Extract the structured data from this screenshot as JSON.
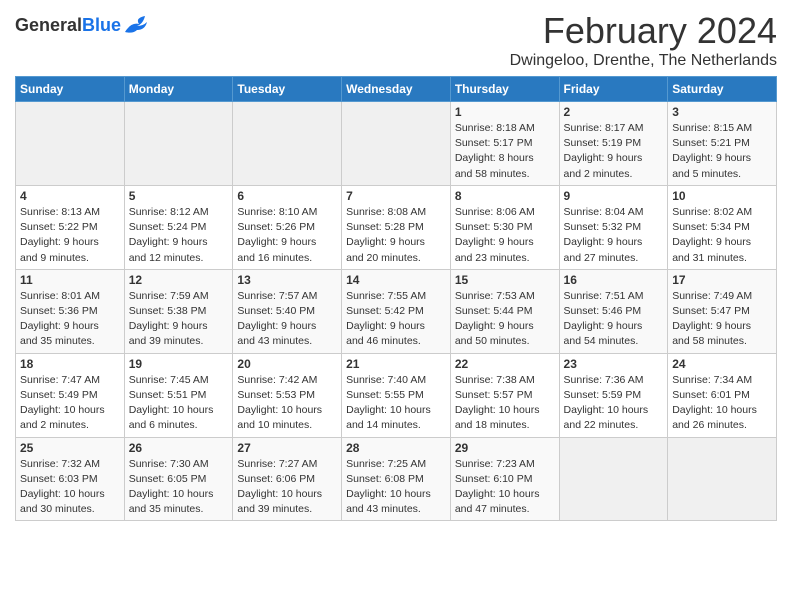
{
  "header": {
    "logo_general": "General",
    "logo_blue": "Blue",
    "month_title": "February 2024",
    "location": "Dwingeloo, Drenthe, The Netherlands"
  },
  "days_of_week": [
    "Sunday",
    "Monday",
    "Tuesday",
    "Wednesday",
    "Thursday",
    "Friday",
    "Saturday"
  ],
  "weeks": [
    [
      {
        "day": "",
        "info": ""
      },
      {
        "day": "",
        "info": ""
      },
      {
        "day": "",
        "info": ""
      },
      {
        "day": "",
        "info": ""
      },
      {
        "day": "1",
        "info": "Sunrise: 8:18 AM\nSunset: 5:17 PM\nDaylight: 8 hours\nand 58 minutes."
      },
      {
        "day": "2",
        "info": "Sunrise: 8:17 AM\nSunset: 5:19 PM\nDaylight: 9 hours\nand 2 minutes."
      },
      {
        "day": "3",
        "info": "Sunrise: 8:15 AM\nSunset: 5:21 PM\nDaylight: 9 hours\nand 5 minutes."
      }
    ],
    [
      {
        "day": "4",
        "info": "Sunrise: 8:13 AM\nSunset: 5:22 PM\nDaylight: 9 hours\nand 9 minutes."
      },
      {
        "day": "5",
        "info": "Sunrise: 8:12 AM\nSunset: 5:24 PM\nDaylight: 9 hours\nand 12 minutes."
      },
      {
        "day": "6",
        "info": "Sunrise: 8:10 AM\nSunset: 5:26 PM\nDaylight: 9 hours\nand 16 minutes."
      },
      {
        "day": "7",
        "info": "Sunrise: 8:08 AM\nSunset: 5:28 PM\nDaylight: 9 hours\nand 20 minutes."
      },
      {
        "day": "8",
        "info": "Sunrise: 8:06 AM\nSunset: 5:30 PM\nDaylight: 9 hours\nand 23 minutes."
      },
      {
        "day": "9",
        "info": "Sunrise: 8:04 AM\nSunset: 5:32 PM\nDaylight: 9 hours\nand 27 minutes."
      },
      {
        "day": "10",
        "info": "Sunrise: 8:02 AM\nSunset: 5:34 PM\nDaylight: 9 hours\nand 31 minutes."
      }
    ],
    [
      {
        "day": "11",
        "info": "Sunrise: 8:01 AM\nSunset: 5:36 PM\nDaylight: 9 hours\nand 35 minutes."
      },
      {
        "day": "12",
        "info": "Sunrise: 7:59 AM\nSunset: 5:38 PM\nDaylight: 9 hours\nand 39 minutes."
      },
      {
        "day": "13",
        "info": "Sunrise: 7:57 AM\nSunset: 5:40 PM\nDaylight: 9 hours\nand 43 minutes."
      },
      {
        "day": "14",
        "info": "Sunrise: 7:55 AM\nSunset: 5:42 PM\nDaylight: 9 hours\nand 46 minutes."
      },
      {
        "day": "15",
        "info": "Sunrise: 7:53 AM\nSunset: 5:44 PM\nDaylight: 9 hours\nand 50 minutes."
      },
      {
        "day": "16",
        "info": "Sunrise: 7:51 AM\nSunset: 5:46 PM\nDaylight: 9 hours\nand 54 minutes."
      },
      {
        "day": "17",
        "info": "Sunrise: 7:49 AM\nSunset: 5:47 PM\nDaylight: 9 hours\nand 58 minutes."
      }
    ],
    [
      {
        "day": "18",
        "info": "Sunrise: 7:47 AM\nSunset: 5:49 PM\nDaylight: 10 hours\nand 2 minutes."
      },
      {
        "day": "19",
        "info": "Sunrise: 7:45 AM\nSunset: 5:51 PM\nDaylight: 10 hours\nand 6 minutes."
      },
      {
        "day": "20",
        "info": "Sunrise: 7:42 AM\nSunset: 5:53 PM\nDaylight: 10 hours\nand 10 minutes."
      },
      {
        "day": "21",
        "info": "Sunrise: 7:40 AM\nSunset: 5:55 PM\nDaylight: 10 hours\nand 14 minutes."
      },
      {
        "day": "22",
        "info": "Sunrise: 7:38 AM\nSunset: 5:57 PM\nDaylight: 10 hours\nand 18 minutes."
      },
      {
        "day": "23",
        "info": "Sunrise: 7:36 AM\nSunset: 5:59 PM\nDaylight: 10 hours\nand 22 minutes."
      },
      {
        "day": "24",
        "info": "Sunrise: 7:34 AM\nSunset: 6:01 PM\nDaylight: 10 hours\nand 26 minutes."
      }
    ],
    [
      {
        "day": "25",
        "info": "Sunrise: 7:32 AM\nSunset: 6:03 PM\nDaylight: 10 hours\nand 30 minutes."
      },
      {
        "day": "26",
        "info": "Sunrise: 7:30 AM\nSunset: 6:05 PM\nDaylight: 10 hours\nand 35 minutes."
      },
      {
        "day": "27",
        "info": "Sunrise: 7:27 AM\nSunset: 6:06 PM\nDaylight: 10 hours\nand 39 minutes."
      },
      {
        "day": "28",
        "info": "Sunrise: 7:25 AM\nSunset: 6:08 PM\nDaylight: 10 hours\nand 43 minutes."
      },
      {
        "day": "29",
        "info": "Sunrise: 7:23 AM\nSunset: 6:10 PM\nDaylight: 10 hours\nand 47 minutes."
      },
      {
        "day": "",
        "info": ""
      },
      {
        "day": "",
        "info": ""
      }
    ]
  ]
}
